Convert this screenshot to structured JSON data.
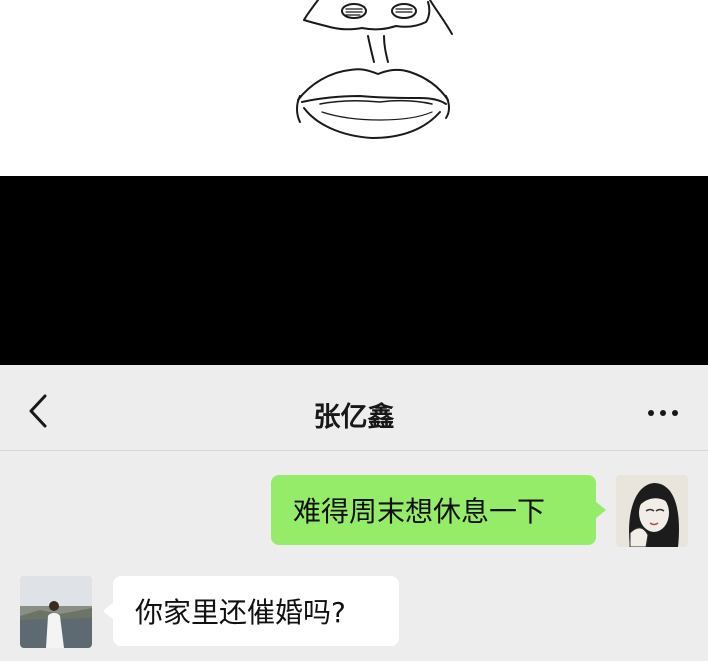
{
  "chat": {
    "contact_name": "张亿鑫",
    "messages": [
      {
        "sender": "me",
        "text": "难得周末想休息一下"
      },
      {
        "sender": "contact",
        "text": "你家里还催婚吗?"
      }
    ]
  },
  "icons": {
    "back": "chevron-left-icon",
    "more": "more-dots-icon"
  },
  "colors": {
    "sent_bubble": "#95ec69",
    "received_bubble": "#ffffff",
    "chat_background": "#ededed",
    "band": "#000000"
  }
}
